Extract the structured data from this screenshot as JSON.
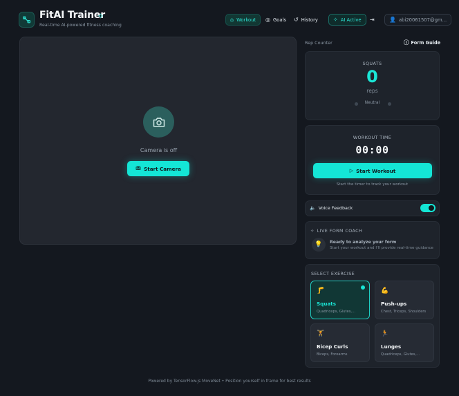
{
  "app": {
    "title": "FitAI Trainer",
    "subtitle": "Real-time AI-powered fitness coaching"
  },
  "nav": {
    "workout": "Workout",
    "goals": "Goals",
    "history": "History",
    "ai_active": "AI Active",
    "user_email": "abi20061507@gm..."
  },
  "camera": {
    "status": "Camera is off",
    "start_label": "Start Camera"
  },
  "rep_counter": {
    "section_label": "Rep Counter",
    "form_guide_label": "Form Guide",
    "exercise": "SQUATS",
    "count": "0",
    "unit": "reps",
    "state": "Neutral"
  },
  "workout_time": {
    "label": "WORKOUT TIME",
    "time": "00:00",
    "start_label": "Start Workout",
    "hint": "Start the timer to track your workout"
  },
  "voice": {
    "label": "Voice Feedback",
    "enabled": true
  },
  "coach": {
    "title": "LIVE FORM COACH",
    "main": "Ready to analyze your form",
    "sub": "Start your workout and I'll provide real-time guidance"
  },
  "exercises": {
    "title": "SELECT EXERCISE",
    "items": [
      {
        "name": "Squats",
        "muscles": "Quadriceps, Glutes,...",
        "emoji": "🦵",
        "selected": true
      },
      {
        "name": "Push-ups",
        "muscles": "Chest, Triceps, Shoulders",
        "emoji": "💪",
        "selected": false
      },
      {
        "name": "Bicep Curls",
        "muscles": "Biceps, Forearms",
        "emoji": "🏋",
        "selected": false
      },
      {
        "name": "Lunges",
        "muscles": "Quadriceps, Glutes,...",
        "emoji": "🏃",
        "selected": false
      }
    ]
  },
  "footer": {
    "text": "Powered by TensorFlow.js MoveNet • Position yourself in frame for best results"
  },
  "colors": {
    "accent": "#14e6d6",
    "background": "#14181f",
    "panel": "#1e232b"
  }
}
